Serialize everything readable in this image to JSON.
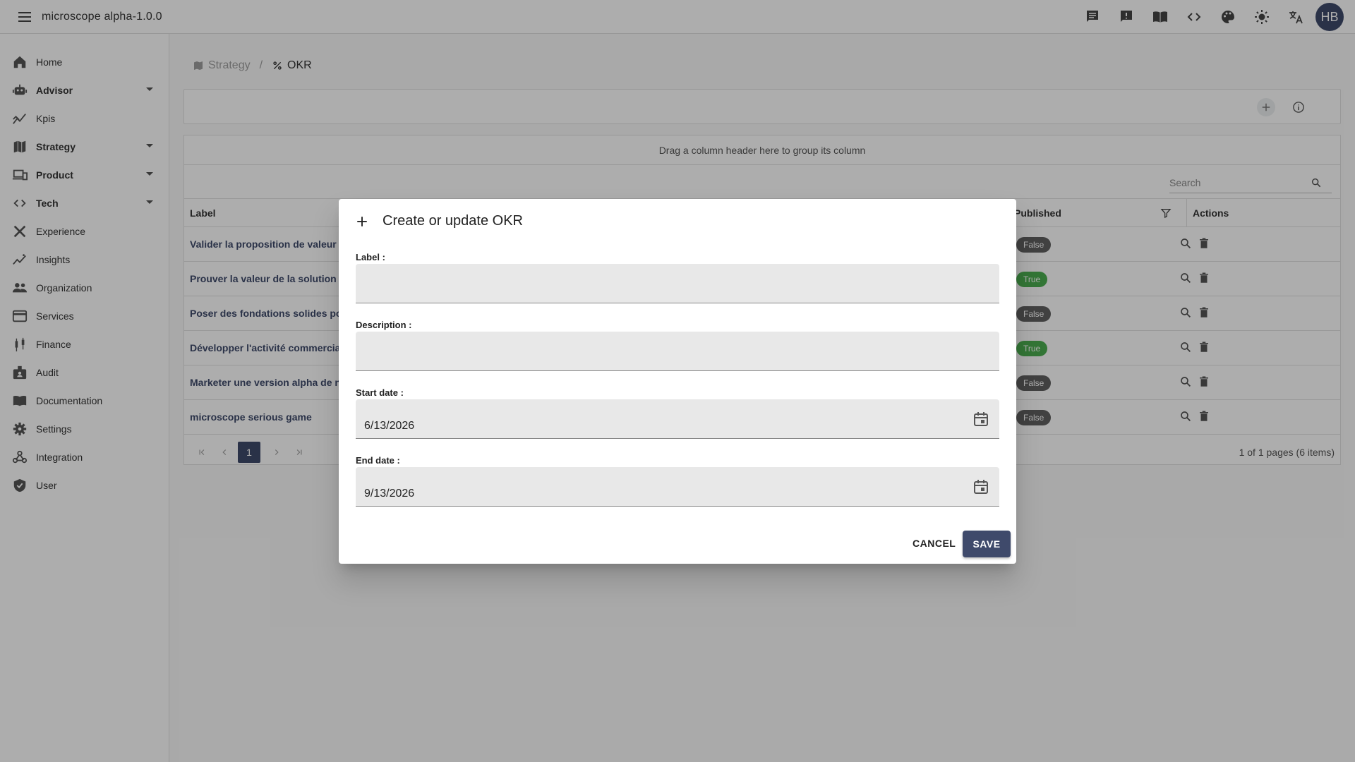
{
  "app": {
    "title": "microscope  alpha-1.0.0",
    "user_initials": "HB"
  },
  "topbar": {
    "icons": [
      "message-icon",
      "feedback-icon",
      "book-icon",
      "code-icon",
      "palette-icon",
      "brightness-icon",
      "translate-icon"
    ]
  },
  "sidebar": {
    "items": [
      {
        "label": "Home",
        "icon": "home-icon",
        "expandable": false
      },
      {
        "label": "Advisor",
        "icon": "robot-icon",
        "expandable": true
      },
      {
        "label": "Kpis",
        "icon": "chart-line-icon",
        "expandable": false
      },
      {
        "label": "Strategy",
        "icon": "map-icon",
        "expandable": true
      },
      {
        "label": "Product",
        "icon": "devices-icon",
        "expandable": true
      },
      {
        "label": "Tech",
        "icon": "code-icon",
        "expandable": true
      },
      {
        "label": "Experience",
        "icon": "design-icon",
        "expandable": false
      },
      {
        "label": "Insights",
        "icon": "insights-icon",
        "expandable": false
      },
      {
        "label": "Organization",
        "icon": "people-icon",
        "expandable": false
      },
      {
        "label": "Services",
        "icon": "card-icon",
        "expandable": false
      },
      {
        "label": "Finance",
        "icon": "candlestick-icon",
        "expandable": false
      },
      {
        "label": "Audit",
        "icon": "badge-icon",
        "expandable": false
      },
      {
        "label": "Documentation",
        "icon": "book-icon",
        "expandable": false
      },
      {
        "label": "Settings",
        "icon": "gear-icon",
        "expandable": false
      },
      {
        "label": "Integration",
        "icon": "webhook-icon",
        "expandable": false
      },
      {
        "label": "User",
        "icon": "shield-icon",
        "expandable": false
      }
    ]
  },
  "breadcrumb": {
    "parent": "Strategy",
    "separator": "/",
    "current": "OKR"
  },
  "grid": {
    "group_hint": "Drag a column header here to group its column",
    "search_placeholder": "Search",
    "columns": {
      "label": "Label",
      "published": "Published",
      "actions": "Actions"
    },
    "rows": [
      {
        "label": "Valider la proposition de valeur d",
        "published": "False"
      },
      {
        "label": "Prouver la valeur de la solution v",
        "published": "True"
      },
      {
        "label": "Poser des fondations solides pou",
        "published": "False"
      },
      {
        "label": "Développer l'activité commerciale",
        "published": "True"
      },
      {
        "label": "Marketer une version alpha de no",
        "published": "False"
      },
      {
        "label": "microscope serious game",
        "published": "False"
      }
    ],
    "pager": {
      "current_page": "1",
      "info": "1 of 1 pages (6 items)"
    }
  },
  "dialog": {
    "title": "Create or update OKR",
    "fields": {
      "label": {
        "label": "Label :",
        "value": ""
      },
      "description": {
        "label": "Description :",
        "value": ""
      },
      "start_date": {
        "label": "Start date :",
        "value": "6/13/2026"
      },
      "end_date": {
        "label": "End date :",
        "value": "9/13/2026"
      }
    },
    "cancel": "CANCEL",
    "save": "SAVE"
  },
  "colors": {
    "primary": "#3f4a6b",
    "true_badge": "#4caf50",
    "false_badge": "#616161"
  }
}
